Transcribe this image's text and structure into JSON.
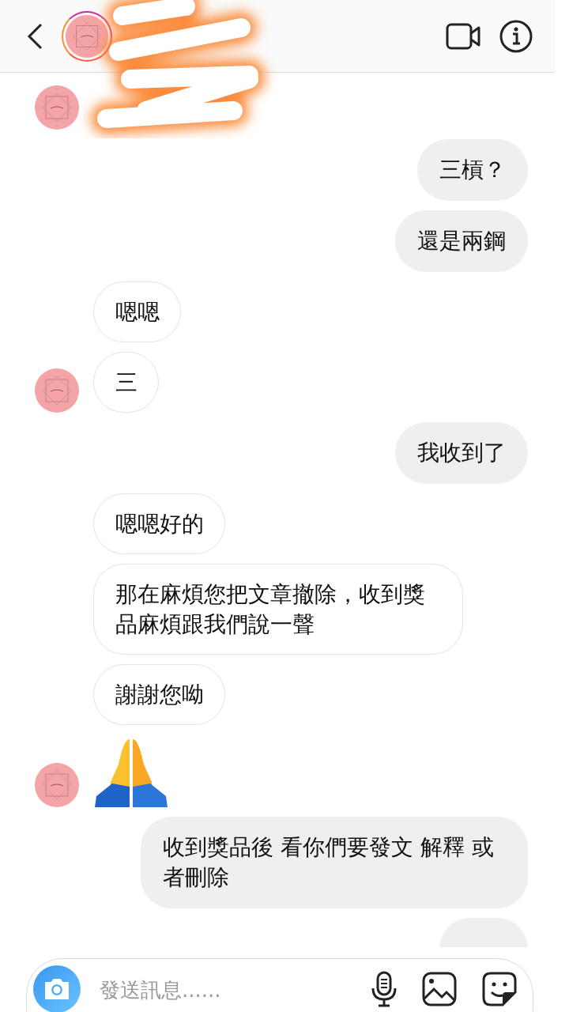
{
  "header": {
    "avatar_ring": true
  },
  "messages": [
    {
      "kind": "redacted",
      "avatar": true
    },
    {
      "kind": "outgoing",
      "text": "三槓？"
    },
    {
      "kind": "outgoing",
      "text": "還是兩鋼"
    },
    {
      "kind": "incoming",
      "text": "嗯嗯",
      "avatar": false
    },
    {
      "kind": "incoming",
      "text": "三",
      "avatar": true
    },
    {
      "kind": "outgoing",
      "text": "我收到了"
    },
    {
      "kind": "incoming",
      "text": "嗯嗯好的",
      "avatar": false
    },
    {
      "kind": "incoming",
      "text": "那在麻煩您把文章撤除，收到獎品麻煩跟我們說一聲",
      "avatar": false
    },
    {
      "kind": "incoming",
      "text": "謝謝您呦",
      "avatar": false
    },
    {
      "kind": "emoji",
      "avatar": true
    },
    {
      "kind": "outgoing",
      "text": "收到獎品後 看你們要發文 解釋 或者刪除"
    },
    {
      "kind": "partial"
    }
  ],
  "composer": {
    "placeholder": "發送訊息......"
  }
}
